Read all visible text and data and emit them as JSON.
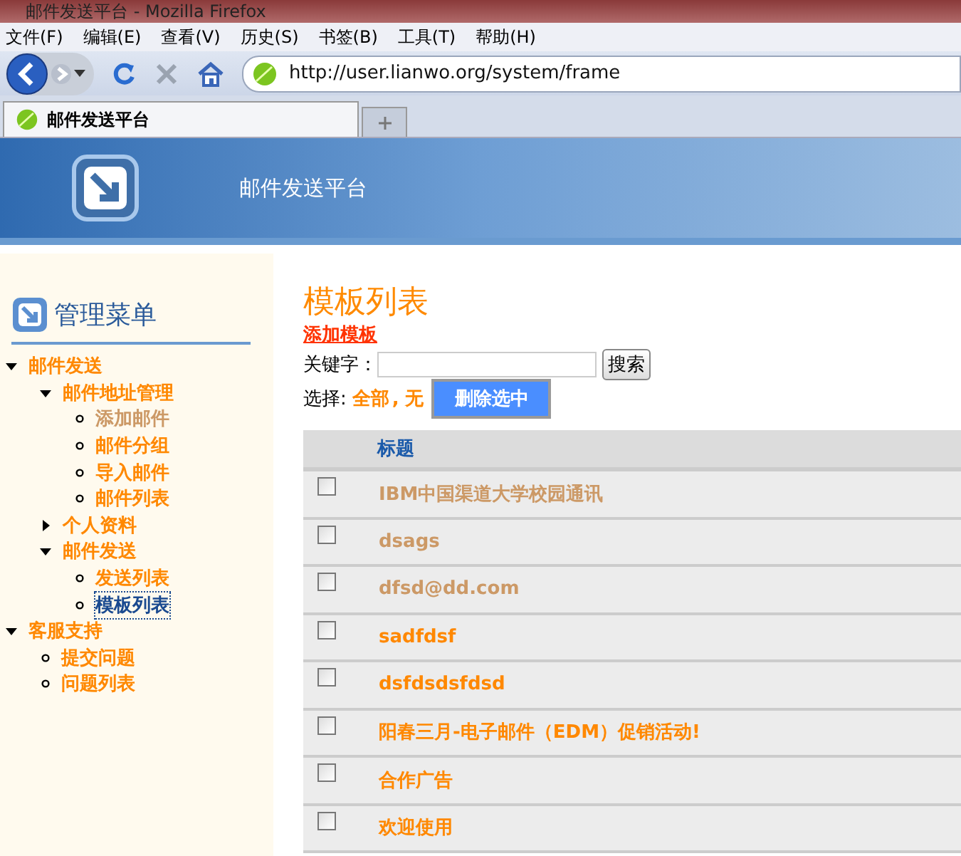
{
  "window": {
    "title": "邮件发送平台 - Mozilla Firefox"
  },
  "menu_bar": [
    "文件(F)",
    "编辑(E)",
    "查看(V)",
    "历史(S)",
    "书签(B)",
    "工具(T)",
    "帮助(H)"
  ],
  "address_bar": {
    "value": "http://user.lianwo.org/system/frame"
  },
  "tabs": [
    {
      "label": "邮件发送平台",
      "selected": true
    }
  ],
  "banner": {
    "title": "邮件发送平台"
  },
  "sidebar": {
    "title": "管理菜单",
    "items": [
      {
        "label": "邮件发送",
        "expanded": true,
        "visited": false,
        "selected": false,
        "children": [
          {
            "label": "邮件地址管理",
            "expanded": true,
            "visited": false,
            "selected": false,
            "children": [
              {
                "label": "添加邮件",
                "visited": true,
                "selected": false
              },
              {
                "label": "邮件分组",
                "visited": false,
                "selected": false
              },
              {
                "label": "导入邮件",
                "visited": false,
                "selected": false
              },
              {
                "label": "邮件列表",
                "visited": false,
                "selected": false
              }
            ]
          },
          {
            "label": "个人资料",
            "expanded": false,
            "visited": false,
            "selected": false
          },
          {
            "label": "邮件发送",
            "expanded": true,
            "visited": false,
            "selected": false,
            "children": [
              {
                "label": "发送列表",
                "visited": false,
                "selected": false
              },
              {
                "label": "模板列表",
                "visited": false,
                "selected": true
              }
            ]
          }
        ]
      },
      {
        "label": "客服支持",
        "expanded": true,
        "visited": false,
        "selected": false,
        "children": [
          {
            "label": "提交问题",
            "visited": false,
            "selected": false
          },
          {
            "label": "问题列表",
            "visited": false,
            "selected": false
          }
        ]
      }
    ]
  },
  "main": {
    "title": "模板列表",
    "add_link": "添加模板",
    "keyword_label": "关键字：",
    "search_button": "搜索",
    "select_label": "选择:",
    "select_all": "全部",
    "separator": ",",
    "select_none": "无",
    "delete_button": "删除选中",
    "table": {
      "columns": [
        "标题"
      ],
      "rows": [
        {
          "title": "IBM中国渠道大学校园通讯",
          "checked": false,
          "visited": true
        },
        {
          "title": "dsags",
          "checked": false,
          "visited": true
        },
        {
          "title": "dfsd@dd.com",
          "checked": false,
          "visited": true
        },
        {
          "title": "sadfdsf",
          "checked": false,
          "visited": false
        },
        {
          "title": "dsfdsdsfdsd",
          "checked": false,
          "visited": false
        },
        {
          "title": "阳春三月-电子邮件（EDM）促销活动!",
          "checked": false,
          "visited": false
        },
        {
          "title": "合作广告",
          "checked": false,
          "visited": false
        },
        {
          "title": "欢迎使用",
          "checked": false,
          "visited": false
        }
      ]
    }
  }
}
